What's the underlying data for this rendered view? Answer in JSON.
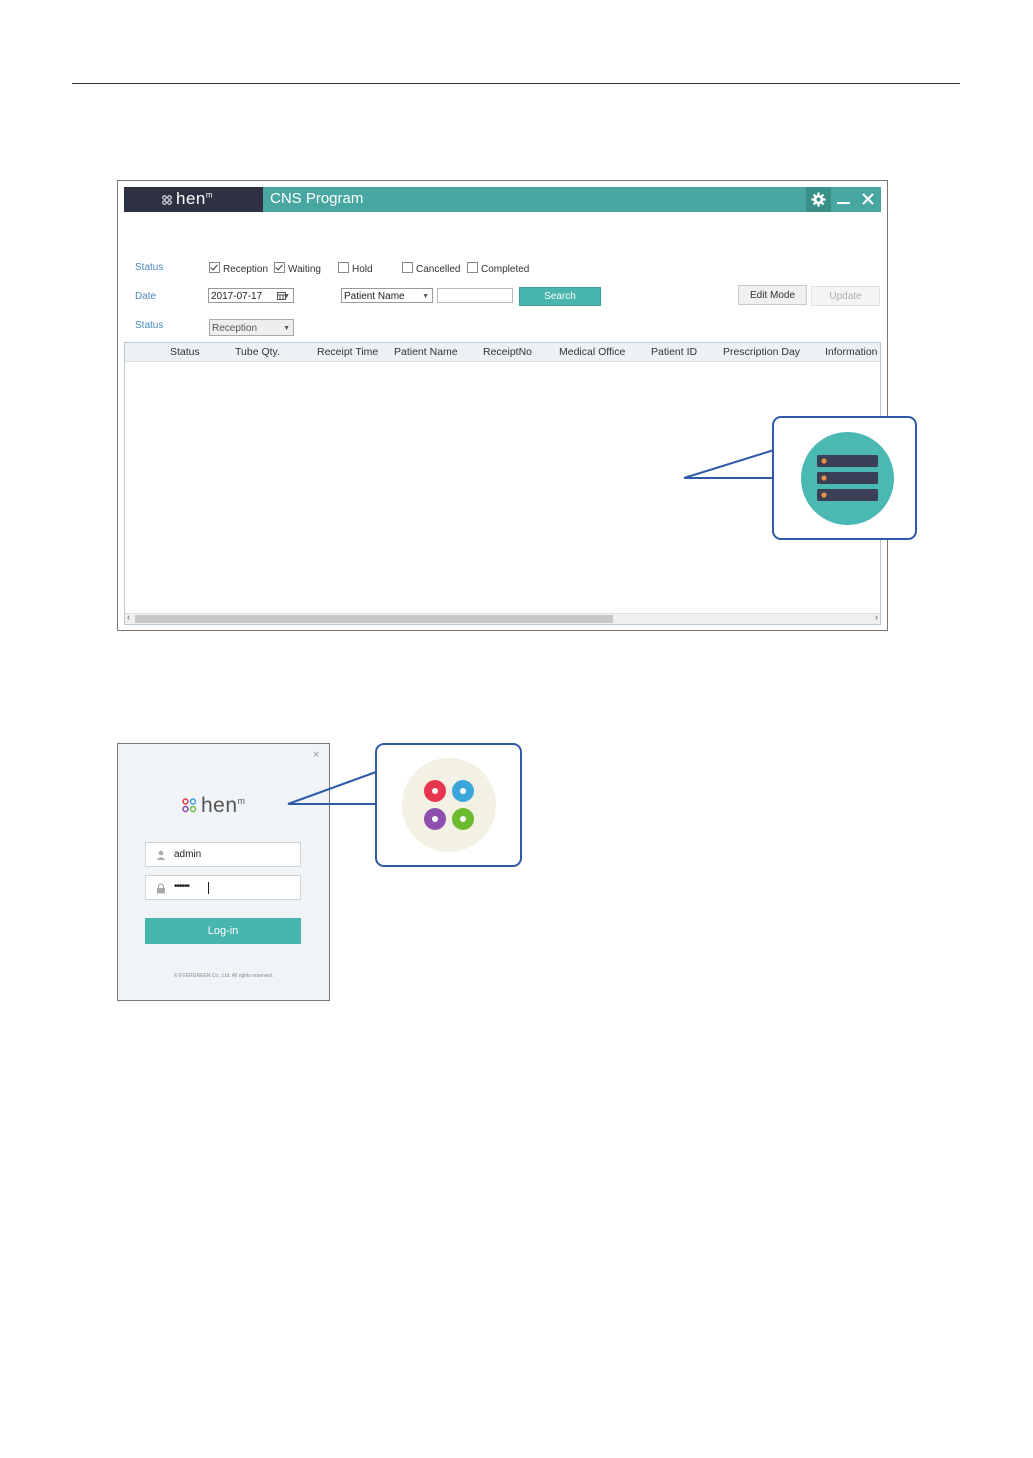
{
  "main_window": {
    "logo_text": "hen",
    "logo_sup": "m",
    "title": "CNS Program",
    "icons": {
      "settings": "gear-icon",
      "minimize": "minimize-icon",
      "close": "close-icon"
    },
    "filters": {
      "status_label": "Status",
      "checkboxes": [
        {
          "label": "Reception",
          "checked": true
        },
        {
          "label": "Waiting",
          "checked": true
        },
        {
          "label": "Hold",
          "checked": false
        },
        {
          "label": "Cancelled",
          "checked": false
        },
        {
          "label": "Completed",
          "checked": false
        }
      ],
      "date_label": "Date",
      "date_value": "2017-07-17",
      "search_field_select": "Patient Name",
      "search_value": "",
      "search_button": "Search",
      "edit_mode_button": "Edit Mode",
      "update_button": "Update",
      "status2_label": "Status",
      "status2_value": "Reception"
    },
    "table": {
      "columns": [
        "Status",
        "Tube Qty.",
        "Receipt Time",
        "Patient Name",
        "ReceiptNo",
        "Medical Office",
        "Patient ID",
        "Prescription Day",
        "Information"
      ],
      "rows": []
    }
  },
  "callouts": {
    "server_icon": "server-stack-icon",
    "logo_icon": "four-dots-logo-icon"
  },
  "login": {
    "close_label": "×",
    "logo_text": "hen",
    "logo_sup": "m",
    "username": "admin",
    "password_masked": "••••••",
    "login_button": "Log-in",
    "copyright": "© EVERGREEN Co., Ltd. All rights reserved.",
    "icons": {
      "user": "user-icon",
      "lock": "lock-icon"
    }
  },
  "colors": {
    "teal": "#48a7a0",
    "dark": "#2d3142",
    "button_teal": "#48b5ae",
    "callout_border": "#2e5aa8",
    "label_blue": "#4a8ac0"
  }
}
